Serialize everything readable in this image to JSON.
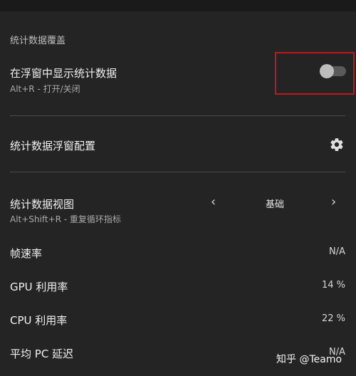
{
  "overlay": {
    "section_title": "统计数据覆盖",
    "show_stats": {
      "title": "在浮窗中显示统计数据",
      "shortcut": "Alt+R - 打开/关闭",
      "enabled": false
    },
    "overlay_config": {
      "title": "统计数据浮窗配置",
      "icon": "gear-icon"
    },
    "stats_view": {
      "title": "统计数据视图",
      "shortcut": "Alt+Shift+R - 重复循环指标",
      "value": "基础",
      "prev_icon": "‹",
      "next_icon": "›"
    },
    "metrics": [
      {
        "label": "帧速率",
        "value": "N/A"
      },
      {
        "label": "GPU 利用率",
        "value": "14 %"
      },
      {
        "label": "CPU 利用率",
        "value": "22 %"
      },
      {
        "label": "平均 PC 延迟",
        "value": "N/A"
      }
    ]
  },
  "watermark": "知乎 @Teamo",
  "colors": {
    "background": "#242424",
    "highlight_box": "#c4151c"
  }
}
